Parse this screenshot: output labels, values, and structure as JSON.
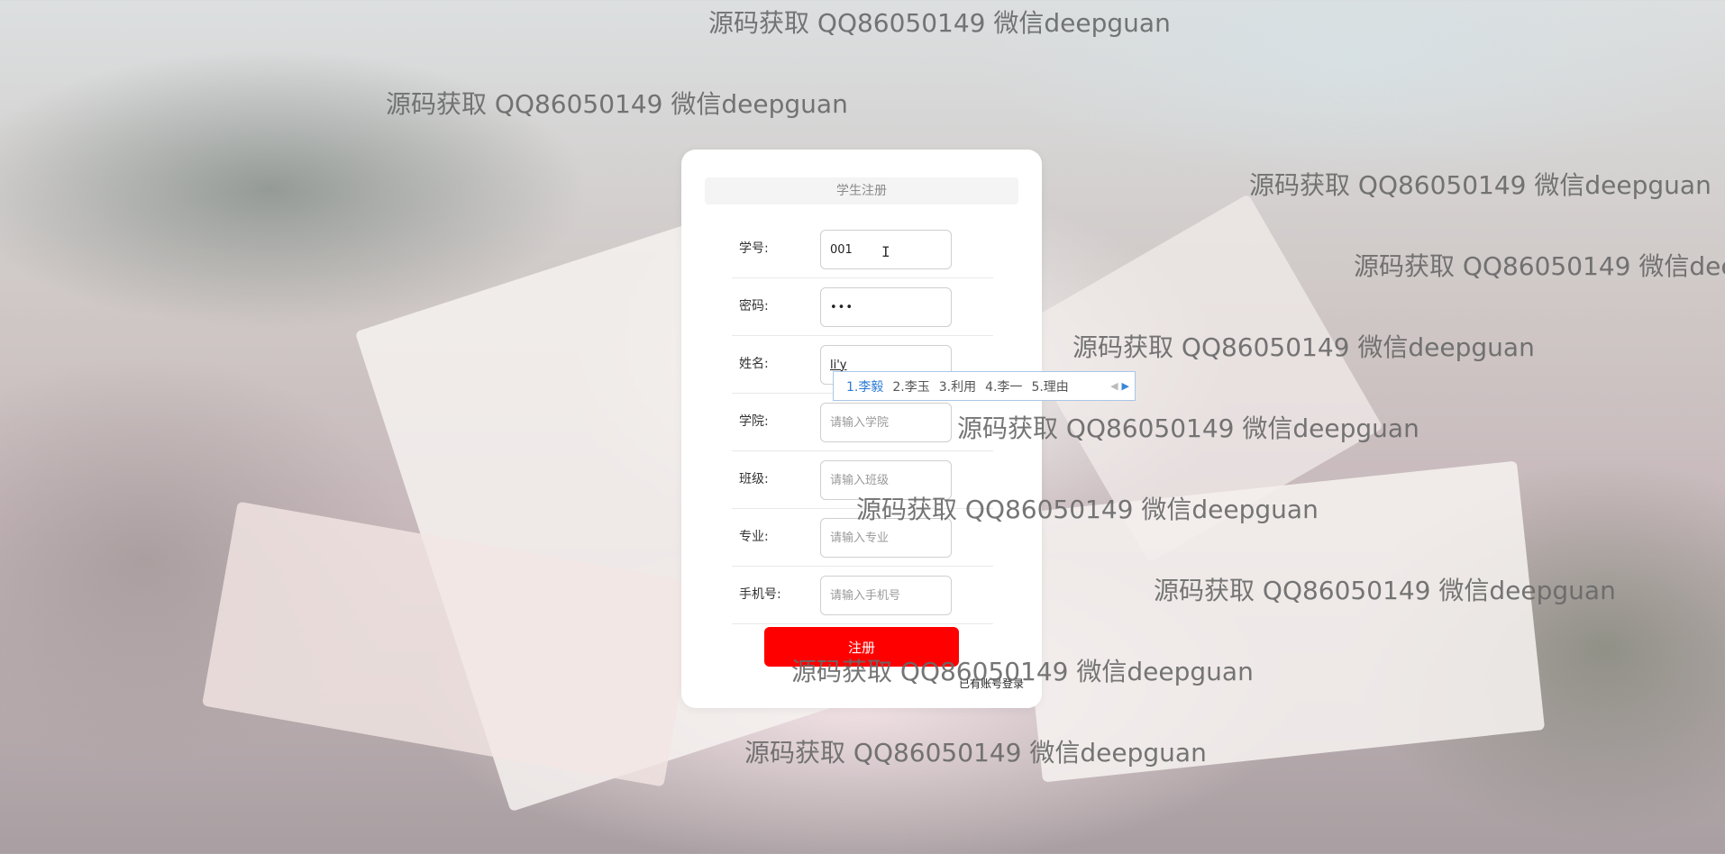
{
  "watermark": "源码获取 QQ86050149 微信deepguan",
  "form": {
    "title": "学生注册",
    "fields": [
      {
        "label": "学号:",
        "value": "001",
        "placeholder": ""
      },
      {
        "label": "密码:",
        "value": "•••",
        "placeholder": ""
      },
      {
        "label": "姓名:",
        "value": "li'y",
        "placeholder": ""
      },
      {
        "label": "学院:",
        "value": "",
        "placeholder": "请输入学院"
      },
      {
        "label": "班级:",
        "value": "",
        "placeholder": "请输入班级"
      },
      {
        "label": "专业:",
        "value": "",
        "placeholder": "请输入专业"
      },
      {
        "label": "手机号:",
        "value": "",
        "placeholder": "请输入手机号"
      }
    ],
    "register_label": "注册",
    "login_link": "已有账号登录"
  },
  "ime": {
    "candidates": [
      "1.李毅",
      "2.李玉",
      "3.利用",
      "4.李一",
      "5.理由"
    ],
    "prev_icon": "chevron-left-icon",
    "next_icon": "chevron-right-icon"
  },
  "colors": {
    "accent": "#ff0000",
    "ime_highlight": "#2a7ad6",
    "card": "#ffffff"
  }
}
